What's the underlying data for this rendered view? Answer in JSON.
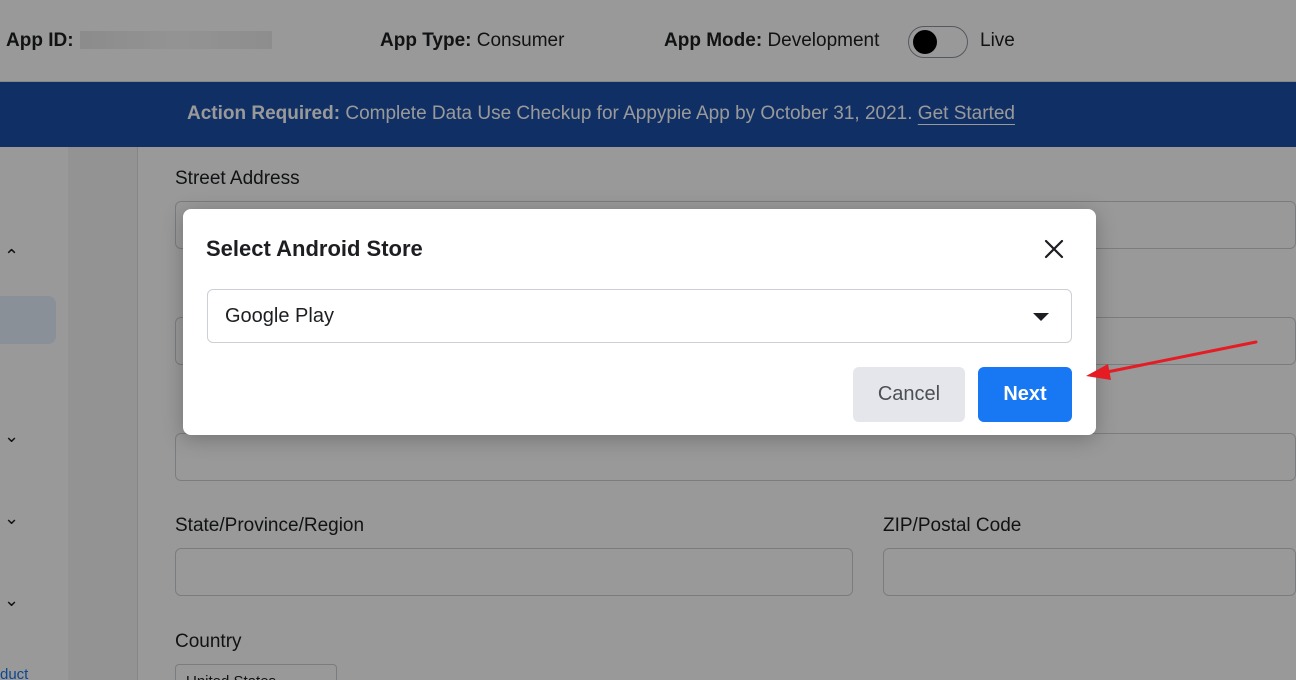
{
  "topbar": {
    "app_id_label": "App ID:",
    "app_type_label": "App Type:",
    "app_type_value": "Consumer",
    "app_mode_label": "App Mode:",
    "app_mode_value": "Development",
    "live_label": "Live"
  },
  "banner": {
    "bold": "Action Required:",
    "text": " Complete Data Use Checkup for Appypie App by October 31, 2021. ",
    "link": "Get Started"
  },
  "form": {
    "street_address": "Street Address",
    "state_label": "State/Province/Region",
    "zip_label": "ZIP/Postal Code",
    "country_label": "Country",
    "country_value": "United States"
  },
  "sidebar": {
    "link_fragment": "duct"
  },
  "modal": {
    "title": "Select Android Store",
    "selected_store": "Google Play",
    "cancel_label": "Cancel",
    "next_label": "Next"
  },
  "colors": {
    "banner": "#1b4fa8",
    "primary": "#1877f2",
    "arrow": "#e51c23"
  }
}
